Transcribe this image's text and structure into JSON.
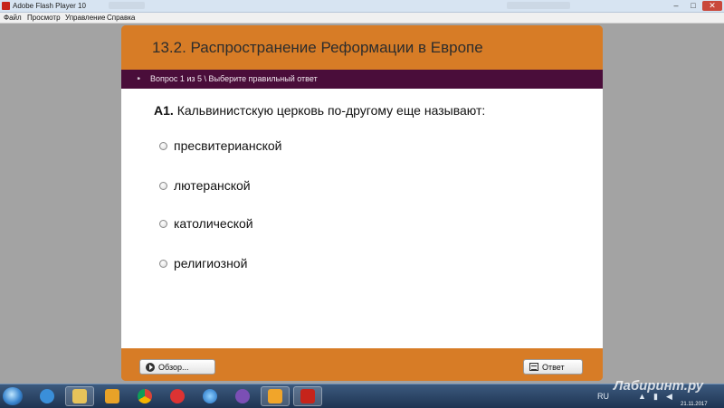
{
  "window": {
    "title": "Adobe Flash Player 10",
    "minimize": "–",
    "maximize": "□",
    "close": "✕"
  },
  "menu": {
    "items": [
      "Файл",
      "Просмотр",
      "Управление",
      "Справка"
    ]
  },
  "quiz": {
    "title": "13.2. Распространение Реформации в Европе",
    "progress": "Вопрос 1 из 5 \\ Выберите правильный ответ",
    "question_number": "А1.",
    "question_text": "Кальвинистскую церковь по-другому еще называют:",
    "options": [
      {
        "label": "пресвитерианской",
        "selected": false
      },
      {
        "label": "лютеранской",
        "selected": false
      },
      {
        "label": "католической",
        "selected": false
      },
      {
        "label": "религиозной",
        "selected": false
      }
    ],
    "browse_button": "Обзор...",
    "answer_button": "Ответ",
    "colors": {
      "accent_orange": "#d77c26",
      "subbar_purple": "#4a0d3a"
    }
  },
  "taskbar": {
    "apps": [
      "start-orb-icon",
      "ie-icon",
      "explorer-icon",
      "media-player-icon",
      "chrome-icon",
      "alarm-app-icon",
      "globe-icon",
      "viber-icon",
      "checkbox-app-icon",
      "flash-icon"
    ],
    "watermark": "Лабиринт.ру",
    "clock_date": "21.11.2017"
  }
}
